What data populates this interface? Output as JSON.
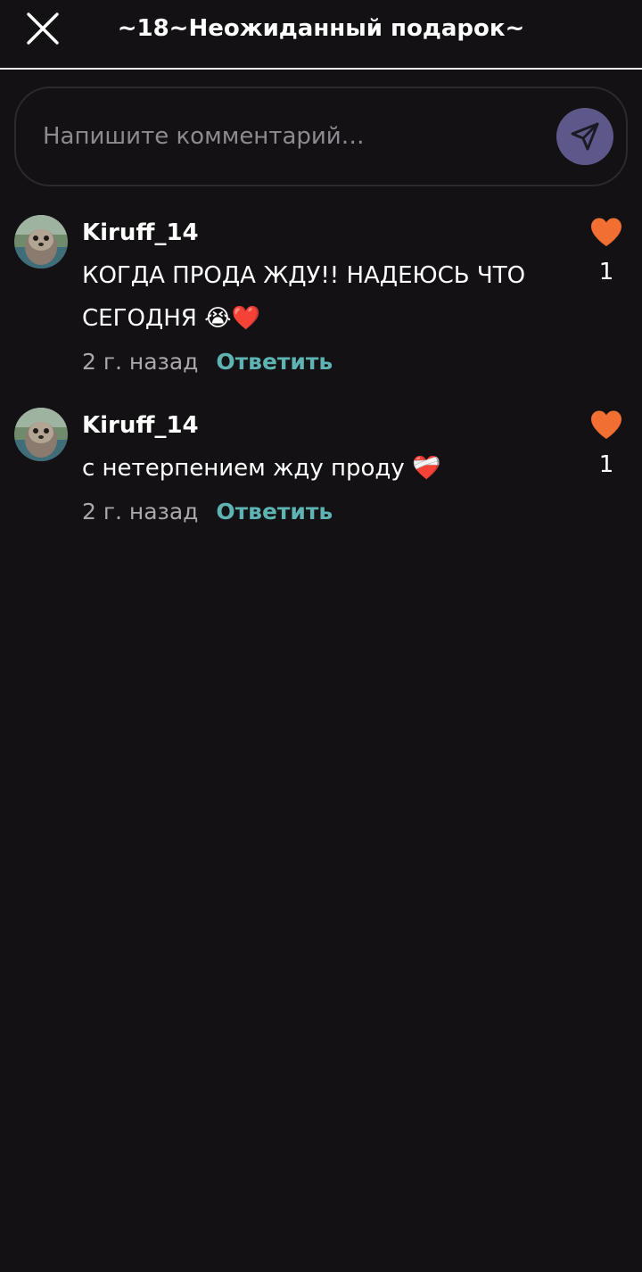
{
  "header": {
    "title": "~18~Неожиданный подарок~",
    "close_icon": "close-icon"
  },
  "composer": {
    "placeholder": "Напишите комментарий…",
    "send_icon": "send-icon"
  },
  "comments": [
    {
      "username": "Kiruff_14",
      "text": "КОГДА ПРОДА ЖДУ!! НАДЕЮСЬ ЧТО СЕГОДНЯ 😭❤️",
      "time": "2 г. назад",
      "reply_label": "Ответить",
      "likes": "1"
    },
    {
      "username": "Kiruff_14",
      "text": "с нетерпением жду проду ❤️‍🩹",
      "time": "2 г. назад",
      "reply_label": "Ответить",
      "likes": "1"
    }
  ],
  "colors": {
    "background": "#131114",
    "accent_like": "#f26f33",
    "reply": "#5fb3b3",
    "send_button": "#5d5889"
  }
}
